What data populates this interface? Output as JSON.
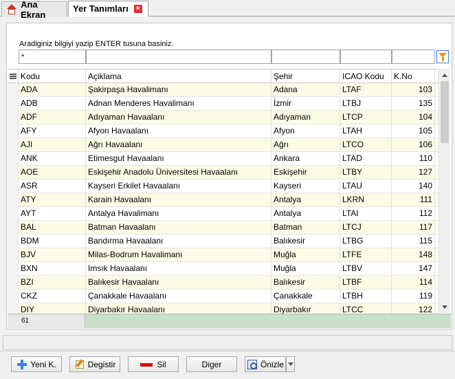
{
  "tabs": {
    "home_label": "Ana Ekran",
    "active_label": "Yer Tanımları"
  },
  "search": {
    "hint": "Aradiginiz bilgiyi yazip ENTER tusuna basiniz.",
    "filter_kodu": "*",
    "filter_aciklama": "",
    "filter_sehir": "",
    "filter_icao": "",
    "filter_kno": ""
  },
  "grid": {
    "headers": {
      "kodu": "Kodu",
      "aciklama": "Açiklama",
      "sehir": "Şehir",
      "icao": "ICAO Kodu",
      "kno": "K.No"
    },
    "rows": [
      {
        "kodu": "ADA",
        "aciklama": "Şakirpaşa Havalimanı",
        "sehir": "Adana",
        "icao": "LTAF",
        "kno": "103"
      },
      {
        "kodu": "ADB",
        "aciklama": "Adnan Menderes Havalimanı",
        "sehir": "İzmir",
        "icao": "LTBJ",
        "kno": "135"
      },
      {
        "kodu": "ADF",
        "aciklama": "Adıyaman Havaalanı",
        "sehir": "Adıyaman",
        "icao": "LTCP",
        "kno": "104"
      },
      {
        "kodu": "AFY",
        "aciklama": "Afyon Havaalanı",
        "sehir": "Afyon",
        "icao": "LTAH",
        "kno": "105"
      },
      {
        "kodu": "AJI",
        "aciklama": "Ağrı Havaalanı",
        "sehir": "Ağrı",
        "icao": "LTCO",
        "kno": "106"
      },
      {
        "kodu": "ANK",
        "aciklama": "Etimesgut Havaalanı",
        "sehir": "Ankara",
        "icao": "LTAD",
        "kno": "110"
      },
      {
        "kodu": "AOE",
        "aciklama": "Eskişehir Anadolu Üniversitesi Havaalanı",
        "sehir": "Eskişehir",
        "icao": "LTBY",
        "kno": "127"
      },
      {
        "kodu": "ASR",
        "aciklama": "Kayseri Erkilet Havaalanı",
        "sehir": "Kayseri",
        "icao": "LTAU",
        "kno": "140"
      },
      {
        "kodu": "ATY",
        "aciklama": "Karain Havaalanı",
        "sehir": "Antalya",
        "icao": "LKRN",
        "kno": "111"
      },
      {
        "kodu": "AYT",
        "aciklama": "Antalya Havalimanı",
        "sehir": "Antalya",
        "icao": "LTAI",
        "kno": "112"
      },
      {
        "kodu": "BAL",
        "aciklama": "Batman Havaalanı",
        "sehir": "Batman",
        "icao": "LTCJ",
        "kno": "117"
      },
      {
        "kodu": "BDM",
        "aciklama": "Bandırma Havaalanı",
        "sehir": "Balıkesir",
        "icao": "LTBG",
        "kno": "115"
      },
      {
        "kodu": "BJV",
        "aciklama": "Milas-Bodrum Havalimanı",
        "sehir": "Muğla",
        "icao": "LTFE",
        "kno": "148"
      },
      {
        "kodu": "BXN",
        "aciklama": "Imsık Havaalanı",
        "sehir": "Muğla",
        "icao": "LTBV",
        "kno": "147"
      },
      {
        "kodu": "BZI",
        "aciklama": "Balıkesir Havaalanı",
        "sehir": "Balıkesir",
        "icao": "LTBF",
        "kno": "114"
      },
      {
        "kodu": "CKZ",
        "aciklama": "Çanakkale Havaalanı",
        "sehir": "Çanakkale",
        "icao": "LTBH",
        "kno": "119"
      },
      {
        "kodu": "DIY",
        "aciklama": "Diyarbakır Havaalanı",
        "sehir": "Diyarbakır",
        "icao": "LTCC",
        "kno": "122"
      }
    ],
    "record_count": "61"
  },
  "toolbar": {
    "new_label": "Yeni K.",
    "edit_label": "Degistir",
    "delete_label": "Sil",
    "other_label": "Diger",
    "preview_label": "Önizle"
  },
  "colors": {
    "row_alt": "#fbfbe6",
    "footer": "#c8e0c8",
    "accent": "#3b7dd8"
  }
}
